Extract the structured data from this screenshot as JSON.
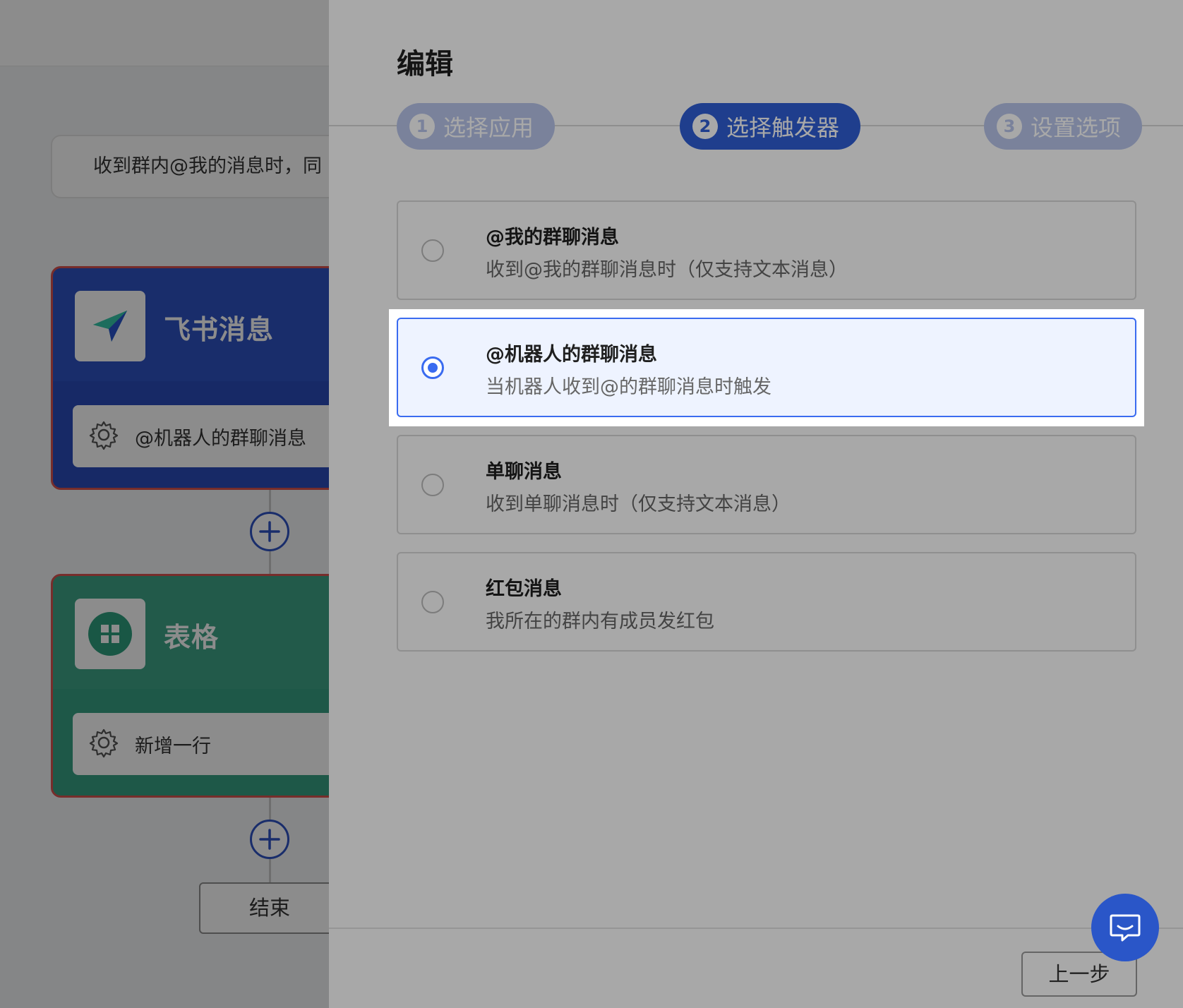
{
  "canvas": {
    "description": "收到群内@我的消息时，同",
    "nodes": [
      {
        "title": "飞书消息",
        "action": "@机器人的群聊消息",
        "color": "#2f53c4",
        "icon": "paper-plane-icon"
      },
      {
        "title": "表格",
        "action": "新增一行",
        "color": "#3ea488",
        "icon": "sheet-grid-icon"
      }
    ],
    "end_label": "结束"
  },
  "drawer": {
    "title": "编辑",
    "steps": [
      {
        "num": "1",
        "label": "选择应用",
        "state": "done"
      },
      {
        "num": "2",
        "label": "选择触发器",
        "state": "active"
      },
      {
        "num": "3",
        "label": "设置选项",
        "state": "pending"
      }
    ],
    "options": [
      {
        "title": "@我的群聊消息",
        "desc": "收到@我的群聊消息时（仅支持文本消息）",
        "selected": false
      },
      {
        "title": "@机器人的群聊消息",
        "desc": "当机器人收到@的群聊消息时触发",
        "selected": true
      },
      {
        "title": "单聊消息",
        "desc": "收到单聊消息时（仅支持文本消息）",
        "selected": false
      },
      {
        "title": "红包消息",
        "desc": "我所在的群内有成员发红包",
        "selected": false
      }
    ],
    "prev_label": "上一步"
  },
  "colors": {
    "primary": "#2f5fd6",
    "accent": "#3a6bf0",
    "step_inactive": "#b9c6eb"
  }
}
